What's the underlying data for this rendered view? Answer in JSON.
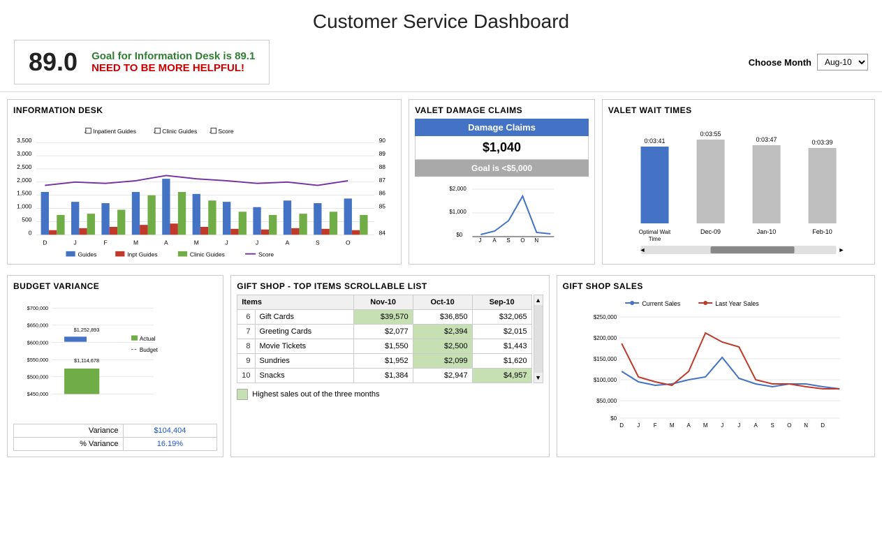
{
  "title": "Customer Service Dashboard",
  "top": {
    "score": "89.0",
    "goal_text": "Goal for Information Desk is 89.1",
    "need_text": "NEED TO BE MORE HELPFUL!",
    "month_label": "Choose Month",
    "month_value": "Aug-10"
  },
  "info_desk": {
    "title": "INFORMATION DESK",
    "legend": [
      "Guides",
      "Inpt Guides",
      "Clinic Guides",
      "Score"
    ]
  },
  "valet_damage": {
    "title": "VALET DAMAGE CLAIMS",
    "header": "Damage Claims",
    "amount": "$1,040",
    "goal": "Goal is <$5,000"
  },
  "valet_wait": {
    "title": "VALET WAIT TIMES",
    "bars": [
      {
        "label": "Optimal Wait\nTime",
        "value": "0:03:41",
        "color": "#4472c4"
      },
      {
        "label": "Dec-09",
        "value": "0:03:55",
        "color": "#bfbfbf"
      },
      {
        "label": "Jan-10",
        "value": "0:03:47",
        "color": "#bfbfbf"
      },
      {
        "label": "Feb-10",
        "value": "0:03:39",
        "color": "#bfbfbf"
      }
    ]
  },
  "budget": {
    "title": "BUDGET VARIANCE",
    "actual_label": "Actual",
    "budget_label": "Budget",
    "actual_value": "$1,252,893",
    "budget_value": "$1,114,678",
    "rows": [
      {
        "label": "Variance",
        "value": "$104,404"
      },
      {
        "label": "% Variance",
        "value": "16.19%"
      }
    ],
    "y_labels": [
      "$700,000",
      "$650,000",
      "$600,000",
      "$550,000",
      "$500,000",
      "$450,000"
    ]
  },
  "gift_shop": {
    "title": "GIFT SHOP - TOP ITEMS  SCROLLABLE LIST",
    "columns": [
      "Items",
      "Nov-10",
      "Oct-10",
      "Sep-10"
    ],
    "rows": [
      {
        "num": "6",
        "item": "Gift Cards",
        "nov": "$39,570",
        "oct": "$36,850",
        "sep": "$32,065",
        "highlight": "nov"
      },
      {
        "num": "7",
        "item": "Greeting Cards",
        "nov": "$2,077",
        "oct": "$2,394",
        "sep": "$2,015",
        "highlight": "oct"
      },
      {
        "num": "8",
        "item": "Movie Tickets",
        "nov": "$1,550",
        "oct": "$2,500",
        "sep": "$1,443",
        "highlight": "oct"
      },
      {
        "num": "9",
        "item": "Sundries",
        "nov": "$1,952",
        "oct": "$2,099",
        "sep": "$1,620",
        "highlight": "oct"
      },
      {
        "num": "10",
        "item": "Snacks",
        "nov": "$1,384",
        "oct": "$2,947",
        "sep": "$4,957",
        "highlight": "sep"
      }
    ],
    "legend_text": "Highest sales out of the three months"
  },
  "gift_sales": {
    "title": "GIFT SHOP SALES",
    "legend": [
      "Current Sales",
      "Last Year Sales"
    ],
    "x_labels": [
      "D",
      "J",
      "F",
      "M",
      "A",
      "M",
      "J",
      "J",
      "A",
      "S",
      "O",
      "N",
      "D"
    ],
    "y_labels": [
      "$250,000",
      "$200,000",
      "$150,000",
      "$100,000",
      "$50,000",
      "$0"
    ]
  }
}
